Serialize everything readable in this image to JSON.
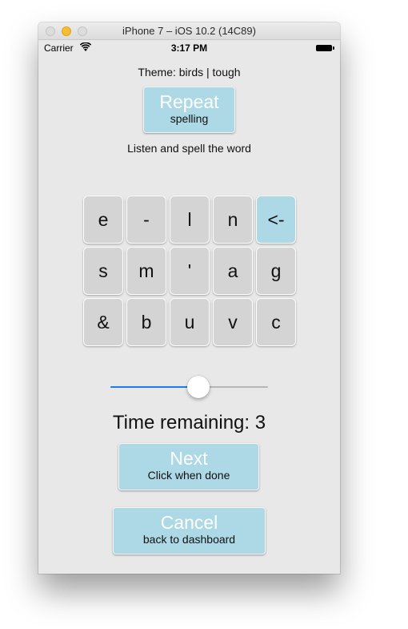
{
  "window": {
    "title": "iPhone 7 – iOS 10.2 (14C89)"
  },
  "status_bar": {
    "carrier": "Carrier",
    "time": "3:17 PM",
    "wifi_icon": "wifi-icon",
    "battery_icon": "battery-icon"
  },
  "screen": {
    "theme_label": "Theme: birds | tough",
    "repeat_button": {
      "label": "Repeat",
      "sublabel": "spelling"
    },
    "instruction": "Listen and spell the word",
    "keypad": {
      "keys": [
        "e",
        "-",
        "l",
        "n",
        "<-",
        "s",
        "m",
        "'",
        "a",
        "g",
        "&",
        "b",
        "u",
        "v",
        "c"
      ],
      "backspace_key": "<-"
    },
    "slider": {
      "value_fraction": 0.56
    },
    "time_remaining": "Time remaining: 3",
    "next_button": {
      "label": "Next",
      "sublabel": "Click when done"
    },
    "cancel_button": {
      "label": "Cancel",
      "sublabel": "back to dashboard"
    }
  },
  "colors": {
    "button_bg": "#add8e6",
    "key_bg": "#d4d4d4",
    "slider_fill": "#1a7cf5",
    "screen_bg": "#e8e8e8"
  }
}
